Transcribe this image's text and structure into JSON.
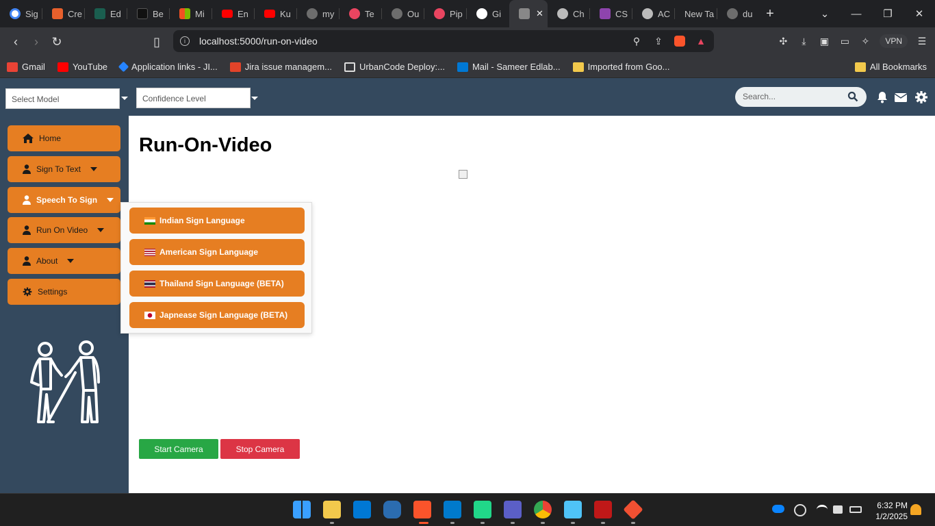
{
  "browser": {
    "tabs": [
      {
        "label": "Sig",
        "icon": "google-icon",
        "color": "#4285f4"
      },
      {
        "label": "Cre",
        "icon": "c-icon",
        "color": "#e8602c"
      },
      {
        "label": "Ed",
        "icon": "c-icon",
        "color": "#1a5e4f"
      },
      {
        "label": "Be",
        "icon": "cbt-icon",
        "color": "#111111"
      },
      {
        "label": "Mi",
        "icon": "microsoft-icon",
        "color": "#f25022"
      },
      {
        "label": "En",
        "icon": "youtube-icon",
        "color": "#ff0000"
      },
      {
        "label": "Ku",
        "icon": "youtube-icon",
        "color": "#ff0000"
      },
      {
        "label": "my",
        "icon": "shield-icon",
        "color": "#6d6d6d"
      },
      {
        "label": "Te",
        "icon": "bot-icon",
        "color": "#e94560"
      },
      {
        "label": "Ou",
        "icon": "shield-icon",
        "color": "#6d6d6d"
      },
      {
        "label": "Pip",
        "icon": "bot-icon",
        "color": "#e94560"
      },
      {
        "label": "Gi",
        "icon": "github-icon",
        "color": "#ffffff"
      },
      {
        "label": "",
        "icon": "hands-icon",
        "color": "#888888",
        "active": true
      },
      {
        "label": "Ch",
        "icon": "openai-icon",
        "color": "#bbbbbb"
      },
      {
        "label": "CS",
        "icon": "braces-icon",
        "color": "#8e44ad"
      },
      {
        "label": "AC",
        "icon": "globe-icon",
        "color": "#bbbbbb"
      },
      {
        "label": "New Ta",
        "icon": "",
        "color": ""
      },
      {
        "label": "du",
        "icon": "shield-icon",
        "color": "#6d6d6d"
      }
    ],
    "url": "localhost:5000/run-on-video",
    "vpn_label": "VPN",
    "bookmarks": [
      {
        "label": "Gmail",
        "icon": "gmail-icon",
        "color": "#ea4335"
      },
      {
        "label": "YouTube",
        "icon": "youtube-icon",
        "color": "#ff0000"
      },
      {
        "label": "Application links - JI...",
        "icon": "jira-icon",
        "color": "#2684ff"
      },
      {
        "label": "Jira issue managem...",
        "icon": "gitlab-icon",
        "color": "#e24329"
      },
      {
        "label": "UrbanCode Deploy:...",
        "icon": "urbancode-icon",
        "color": "#dddddd"
      },
      {
        "label": "Mail - Sameer Edlab...",
        "icon": "outlook-icon",
        "color": "#0078d4"
      },
      {
        "label": "Imported from Goo...",
        "icon": "folder-icon",
        "color": "#f2c94c"
      }
    ],
    "all_bookmarks_label": "All Bookmarks"
  },
  "header": {
    "model_placeholder": "Select Model",
    "confidence_placeholder": "Confidence Level",
    "search_placeholder": "Search..."
  },
  "sidebar": {
    "items": [
      {
        "label": "Home",
        "icon": "home-icon",
        "dropdown": false
      },
      {
        "label": "Sign To Text",
        "icon": "user-icon",
        "dropdown": true
      },
      {
        "label": "Speech To Sign",
        "icon": "user-icon",
        "dropdown": true
      },
      {
        "label": "Run On Video",
        "icon": "user-icon",
        "dropdown": true
      },
      {
        "label": "About",
        "icon": "user-icon",
        "dropdown": true
      },
      {
        "label": "Settings",
        "icon": "gear-icon",
        "dropdown": false
      }
    ]
  },
  "main": {
    "title": "Run-On-Video",
    "start_camera": "Start Camera",
    "stop_camera": "Stop Camera"
  },
  "dropdown": {
    "items": [
      {
        "label": "Indian Sign Language",
        "flag": "india-flag-icon"
      },
      {
        "label": "American Sign Language",
        "flag": "us-flag-icon"
      },
      {
        "label": "Thailand Sign Language (BETA)",
        "flag": "thailand-flag-icon"
      },
      {
        "label": "Japnease Sign Language (BETA)",
        "flag": "japan-flag-icon"
      }
    ]
  },
  "taskbar": {
    "time": "6:32 PM",
    "date": "1/2/2025"
  },
  "colors": {
    "accent": "#e67e22",
    "header_bg": "#34495e",
    "start_button": "#28a745",
    "stop_button": "#dc3545"
  }
}
